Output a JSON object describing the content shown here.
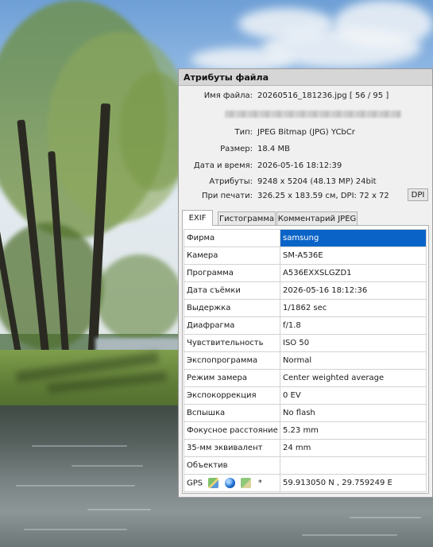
{
  "window": {
    "title": "Атрибуты файла"
  },
  "file_info": [
    {
      "label": "Имя файла:",
      "value": "20260516_181236.jpg   [ 56 / 95 ]"
    },
    {
      "label": "Тип:",
      "value": "JPEG Bitmap (JPG) YCbCr"
    },
    {
      "label": "Размер:",
      "value": "18.4 MB"
    },
    {
      "label": "Дата и время:",
      "value": "2026-05-16 18:12:39"
    },
    {
      "label": "Атрибуты:",
      "value": "9248 x 5204 (48.13 MP)  24bit"
    },
    {
      "label": "При печати:",
      "value": "326.25 x 183.59 см,  DPI: 72 x 72"
    }
  ],
  "dpi_button": "DPI",
  "tabs": [
    {
      "label": "EXIF",
      "active": true
    },
    {
      "label": "Гистограмма",
      "active": false
    },
    {
      "label": "Комментарий JPEG",
      "active": false
    }
  ],
  "exif": [
    {
      "key": "Фирма",
      "value": "samsung",
      "selected": true
    },
    {
      "key": "Камера",
      "value": "SM-A536E"
    },
    {
      "key": "Программа",
      "value": "A536EXXSLGZD1"
    },
    {
      "key": "Дата съёмки",
      "value": "2026-05-16 18:12:36"
    },
    {
      "key": "Выдержка",
      "value": "1/1862 sec"
    },
    {
      "key": "Диафрагма",
      "value": "f/1.8"
    },
    {
      "key": "Чувствительность",
      "value": "ISO 50"
    },
    {
      "key": "Экспопрограмма",
      "value": "Normal"
    },
    {
      "key": "Режим замера",
      "value": "Center weighted average"
    },
    {
      "key": "Экспокоррекция",
      "value": "0 EV"
    },
    {
      "key": "Вспышка",
      "value": "No flash"
    },
    {
      "key": "Фокусное расстояние",
      "value": "5.23 mm"
    },
    {
      "key": "35-мм эквивалент",
      "value": "24 mm"
    },
    {
      "key": "Объектив",
      "value": ""
    }
  ],
  "gps": {
    "label": "GPS",
    "star": "*",
    "value": "59.913050 N  ,  29.759249 E",
    "icons": [
      "map-icon",
      "globe-icon",
      "map-pin-icon"
    ]
  },
  "colors": {
    "selection": "#0a64c8",
    "panel_bg": "#f0f0f0",
    "title_bg": "#d6d6d6"
  }
}
